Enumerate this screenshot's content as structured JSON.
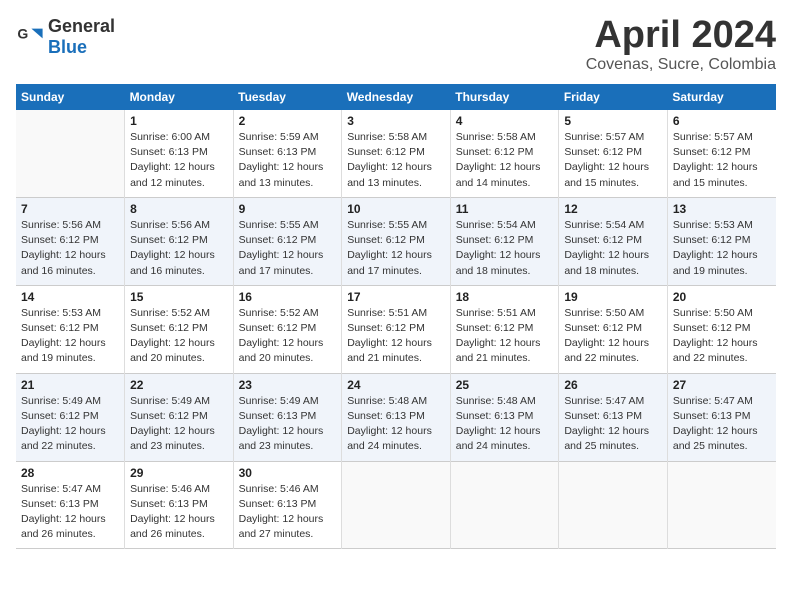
{
  "header": {
    "logo_general": "General",
    "logo_blue": "Blue",
    "title": "April 2024",
    "location": "Covenas, Sucre, Colombia"
  },
  "weekdays": [
    "Sunday",
    "Monday",
    "Tuesday",
    "Wednesday",
    "Thursday",
    "Friday",
    "Saturday"
  ],
  "weeks": [
    [
      {
        "day": "",
        "info": ""
      },
      {
        "day": "1",
        "info": "Sunrise: 6:00 AM\nSunset: 6:13 PM\nDaylight: 12 hours\nand 12 minutes."
      },
      {
        "day": "2",
        "info": "Sunrise: 5:59 AM\nSunset: 6:13 PM\nDaylight: 12 hours\nand 13 minutes."
      },
      {
        "day": "3",
        "info": "Sunrise: 5:58 AM\nSunset: 6:12 PM\nDaylight: 12 hours\nand 13 minutes."
      },
      {
        "day": "4",
        "info": "Sunrise: 5:58 AM\nSunset: 6:12 PM\nDaylight: 12 hours\nand 14 minutes."
      },
      {
        "day": "5",
        "info": "Sunrise: 5:57 AM\nSunset: 6:12 PM\nDaylight: 12 hours\nand 15 minutes."
      },
      {
        "day": "6",
        "info": "Sunrise: 5:57 AM\nSunset: 6:12 PM\nDaylight: 12 hours\nand 15 minutes."
      }
    ],
    [
      {
        "day": "7",
        "info": "Sunrise: 5:56 AM\nSunset: 6:12 PM\nDaylight: 12 hours\nand 16 minutes."
      },
      {
        "day": "8",
        "info": "Sunrise: 5:56 AM\nSunset: 6:12 PM\nDaylight: 12 hours\nand 16 minutes."
      },
      {
        "day": "9",
        "info": "Sunrise: 5:55 AM\nSunset: 6:12 PM\nDaylight: 12 hours\nand 17 minutes."
      },
      {
        "day": "10",
        "info": "Sunrise: 5:55 AM\nSunset: 6:12 PM\nDaylight: 12 hours\nand 17 minutes."
      },
      {
        "day": "11",
        "info": "Sunrise: 5:54 AM\nSunset: 6:12 PM\nDaylight: 12 hours\nand 18 minutes."
      },
      {
        "day": "12",
        "info": "Sunrise: 5:54 AM\nSunset: 6:12 PM\nDaylight: 12 hours\nand 18 minutes."
      },
      {
        "day": "13",
        "info": "Sunrise: 5:53 AM\nSunset: 6:12 PM\nDaylight: 12 hours\nand 19 minutes."
      }
    ],
    [
      {
        "day": "14",
        "info": "Sunrise: 5:53 AM\nSunset: 6:12 PM\nDaylight: 12 hours\nand 19 minutes."
      },
      {
        "day": "15",
        "info": "Sunrise: 5:52 AM\nSunset: 6:12 PM\nDaylight: 12 hours\nand 20 minutes."
      },
      {
        "day": "16",
        "info": "Sunrise: 5:52 AM\nSunset: 6:12 PM\nDaylight: 12 hours\nand 20 minutes."
      },
      {
        "day": "17",
        "info": "Sunrise: 5:51 AM\nSunset: 6:12 PM\nDaylight: 12 hours\nand 21 minutes."
      },
      {
        "day": "18",
        "info": "Sunrise: 5:51 AM\nSunset: 6:12 PM\nDaylight: 12 hours\nand 21 minutes."
      },
      {
        "day": "19",
        "info": "Sunrise: 5:50 AM\nSunset: 6:12 PM\nDaylight: 12 hours\nand 22 minutes."
      },
      {
        "day": "20",
        "info": "Sunrise: 5:50 AM\nSunset: 6:12 PM\nDaylight: 12 hours\nand 22 minutes."
      }
    ],
    [
      {
        "day": "21",
        "info": "Sunrise: 5:49 AM\nSunset: 6:12 PM\nDaylight: 12 hours\nand 22 minutes."
      },
      {
        "day": "22",
        "info": "Sunrise: 5:49 AM\nSunset: 6:12 PM\nDaylight: 12 hours\nand 23 minutes."
      },
      {
        "day": "23",
        "info": "Sunrise: 5:49 AM\nSunset: 6:13 PM\nDaylight: 12 hours\nand 23 minutes."
      },
      {
        "day": "24",
        "info": "Sunrise: 5:48 AM\nSunset: 6:13 PM\nDaylight: 12 hours\nand 24 minutes."
      },
      {
        "day": "25",
        "info": "Sunrise: 5:48 AM\nSunset: 6:13 PM\nDaylight: 12 hours\nand 24 minutes."
      },
      {
        "day": "26",
        "info": "Sunrise: 5:47 AM\nSunset: 6:13 PM\nDaylight: 12 hours\nand 25 minutes."
      },
      {
        "day": "27",
        "info": "Sunrise: 5:47 AM\nSunset: 6:13 PM\nDaylight: 12 hours\nand 25 minutes."
      }
    ],
    [
      {
        "day": "28",
        "info": "Sunrise: 5:47 AM\nSunset: 6:13 PM\nDaylight: 12 hours\nand 26 minutes."
      },
      {
        "day": "29",
        "info": "Sunrise: 5:46 AM\nSunset: 6:13 PM\nDaylight: 12 hours\nand 26 minutes."
      },
      {
        "day": "30",
        "info": "Sunrise: 5:46 AM\nSunset: 6:13 PM\nDaylight: 12 hours\nand 27 minutes."
      },
      {
        "day": "",
        "info": ""
      },
      {
        "day": "",
        "info": ""
      },
      {
        "day": "",
        "info": ""
      },
      {
        "day": "",
        "info": ""
      }
    ]
  ]
}
